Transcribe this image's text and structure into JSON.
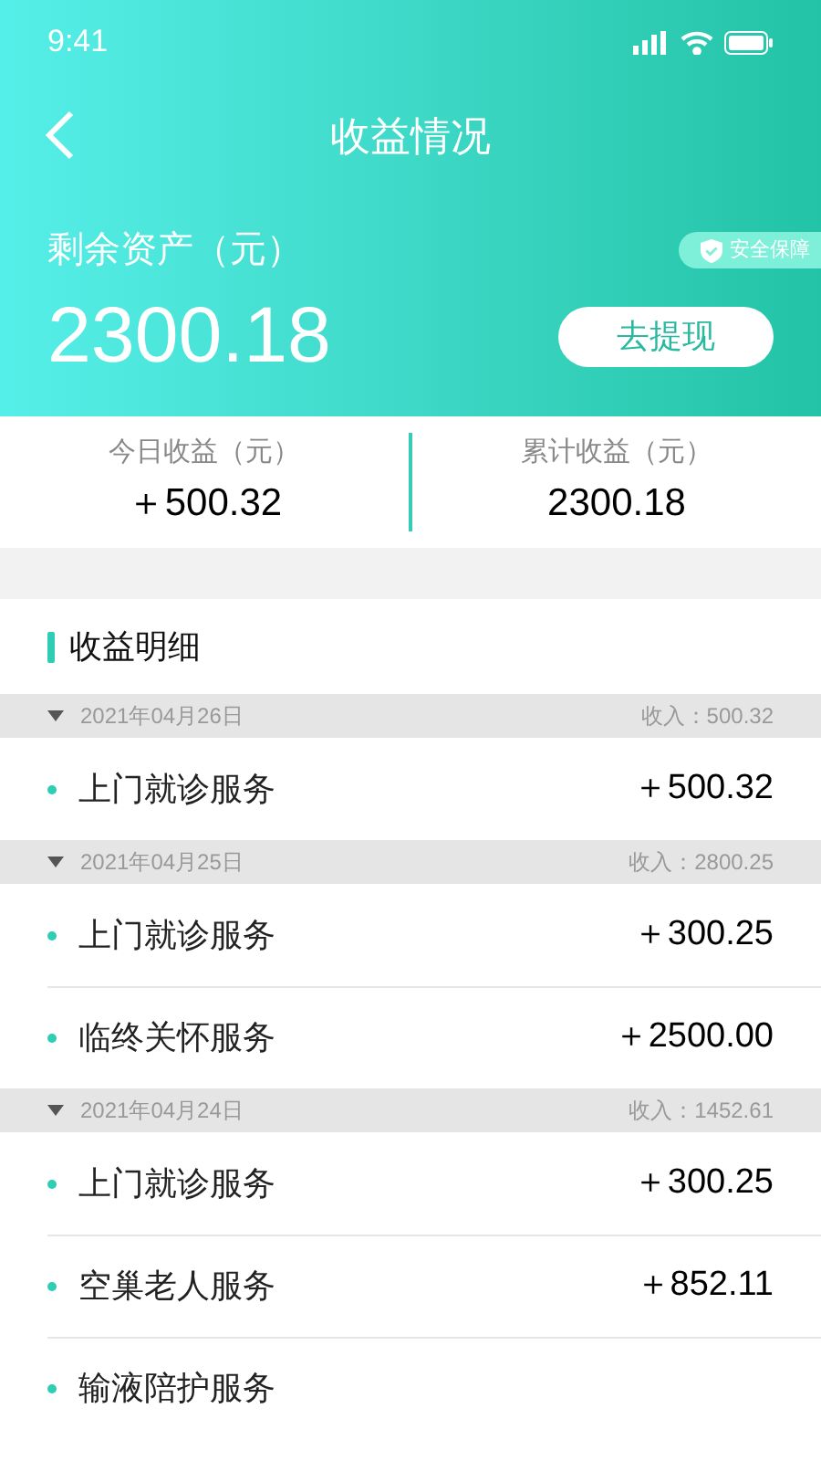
{
  "status_bar": {
    "time": "9:41"
  },
  "header": {
    "title": "收益情况",
    "balance_label": "剩余资产（元）",
    "badge": "安全保障",
    "balance": "2300.18",
    "withdraw_button": "去提现"
  },
  "stats": [
    {
      "label": "今日收益（元）",
      "value": "＋500.32"
    },
    {
      "label": "累计收益（元）",
      "value": "2300.18"
    }
  ],
  "section_title": "收益明细",
  "groups": [
    {
      "date": "2021年04月26日",
      "income": "收入：500.32",
      "expanded": true,
      "items": [
        {
          "name": "上门就诊服务",
          "amount": "＋500.32"
        }
      ]
    },
    {
      "date": "2021年04月25日",
      "income": "收入：2800.25",
      "expanded": true,
      "items": [
        {
          "name": "上门就诊服务",
          "amount": "＋300.25"
        },
        {
          "name": "临终关怀服务",
          "amount": "＋2500.00"
        }
      ]
    },
    {
      "date": "2021年04月24日",
      "income": "收入：1452.61",
      "expanded": true,
      "items": [
        {
          "name": "上门就诊服务",
          "amount": "＋300.25"
        },
        {
          "name": "空巢老人服务",
          "amount": "＋852.11"
        },
        {
          "name": "输液陪护服务"
        }
      ]
    }
  ]
}
